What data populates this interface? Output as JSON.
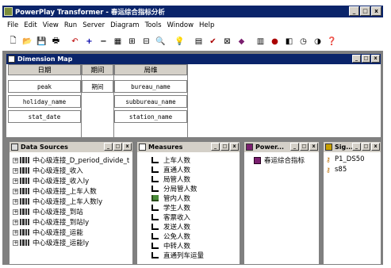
{
  "app": {
    "title": "PowerPlay Transformer - 春运综合指标分析"
  },
  "menu": [
    "File",
    "Edit",
    "View",
    "Run",
    "Server",
    "Diagram",
    "Tools",
    "Window",
    "Help"
  ],
  "toolbar": [
    "new",
    "open",
    "save",
    "print",
    "undo",
    "insert",
    "delete",
    "dim-map",
    "cube",
    "table",
    "find",
    "search",
    "run",
    "check",
    "scope",
    "cube-build",
    "cube-open",
    "update",
    "report",
    "info",
    "help"
  ],
  "dimension_map": {
    "title": "Dimension Map",
    "columns": [
      {
        "header": "日期",
        "cells": [
          "peak",
          "holiday_name",
          "stat_date"
        ]
      },
      {
        "header": "期间",
        "cells": [
          "期间"
        ]
      },
      {
        "header": "局维",
        "cells": [
          "bureau_name",
          "subbureau_name",
          "station_name"
        ]
      }
    ]
  },
  "data_sources": {
    "title": "Data Sources",
    "items": [
      "中心级连接_D_period_divide_t",
      "中心级连接_收入",
      "中心级连接_收入ly",
      "中心级连接_上车人数",
      "中心级连接_上车人数ly",
      "中心级连接_到站",
      "中心级连接_到站ly",
      "中心级连接_运能",
      "中心级连接_运能ly"
    ]
  },
  "measures": {
    "title": "Measures",
    "items": [
      "上车人数",
      "直通人数",
      "局管人数",
      "分局管人数",
      "管内人数",
      "学生人数",
      "客票收入",
      "发送人数",
      "公免人数",
      "中转人数",
      "直通列车运量"
    ]
  },
  "power_cubes": {
    "title": "Power...",
    "items": [
      "春运综合指标"
    ]
  },
  "signons": {
    "title": "Sig...",
    "items": [
      "P1_DS50",
      "s85"
    ]
  },
  "colors": {
    "titlebar": "#0a246a",
    "face": "#d4d0c8",
    "mdi": "#808080"
  }
}
